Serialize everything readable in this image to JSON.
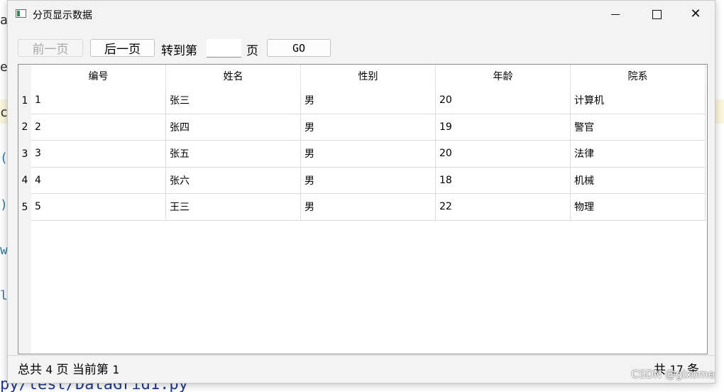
{
  "window": {
    "title": "分页显示数据",
    "controls": {
      "minimize": "—",
      "maximize": "☐",
      "close": "✕"
    }
  },
  "toolbar": {
    "prev_label": "前一页",
    "next_label": "后一页",
    "goto_label": "转到第",
    "page_input_value": "",
    "page_label": "页",
    "go_label": "GO"
  },
  "table": {
    "columns": [
      "编号",
      "姓名",
      "性别",
      "年龄",
      "院系"
    ],
    "rows": [
      {
        "num": "1",
        "cells": [
          "1",
          "张三",
          "男",
          "20",
          "计算机"
        ]
      },
      {
        "num": "2",
        "cells": [
          "2",
          "张四",
          "男",
          "19",
          "警官"
        ]
      },
      {
        "num": "3",
        "cells": [
          "3",
          "张五",
          "男",
          "20",
          "法律"
        ]
      },
      {
        "num": "4",
        "cells": [
          "4",
          "张六",
          "男",
          "18",
          "机械"
        ]
      },
      {
        "num": "5",
        "cells": [
          "5",
          "王三",
          "男",
          "22",
          "物理"
        ]
      }
    ]
  },
  "status": {
    "total_prefix": "总共",
    "total_pages": "4",
    "page_word": "页",
    "current_prefix": "当前第",
    "current_page": "1",
    "count_prefix": "共",
    "record_count": "17",
    "count_suffix": "条"
  },
  "watermark": "CSDN @gixome",
  "background_editor": {
    "bottom_text": "py/test/DataGrid1.py",
    "glyphs": [
      "a",
      "e",
      "c",
      "(",
      ")",
      "w",
      "l"
    ]
  }
}
